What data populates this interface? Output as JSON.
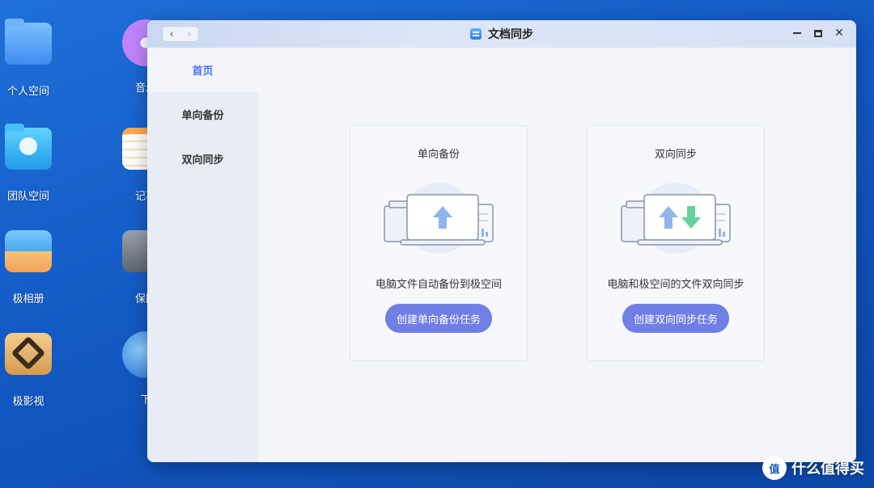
{
  "desktop": {
    "icons": [
      {
        "label": "个人空间",
        "icon": "folder-icon"
      },
      {
        "label": "团队空间",
        "icon": "team-folder-icon"
      },
      {
        "label": "极相册",
        "icon": "album-icon"
      },
      {
        "label": "极影视",
        "icon": "video-icon"
      },
      {
        "label": "音乐",
        "icon": "music-icon"
      },
      {
        "label": "记事",
        "icon": "notes-icon"
      },
      {
        "label": "保险",
        "icon": "safe-icon"
      },
      {
        "label": "下",
        "icon": "globe-icon"
      }
    ]
  },
  "window": {
    "title": "文档同步",
    "nav_back": "‹",
    "nav_forward": "›",
    "close": "✕"
  },
  "sidebar": {
    "items": [
      {
        "label": "首页",
        "active": true
      },
      {
        "label": "单向备份",
        "active": false
      },
      {
        "label": "双向同步",
        "active": false
      }
    ]
  },
  "cards": [
    {
      "title": "单向备份",
      "description": "电脑文件自动备份到极空间",
      "button": "创建单向备份任务"
    },
    {
      "title": "双向同步",
      "description": "电脑和极空间的文件双向同步",
      "button": "创建双向同步任务"
    }
  ],
  "colors": {
    "accent": "#4c6ef5",
    "button": "#6f7fe6",
    "upload_arrow": "#8fb6ea",
    "download_arrow": "#5fd39a"
  },
  "watermark": {
    "logo": "值",
    "text": "什么值得买"
  }
}
